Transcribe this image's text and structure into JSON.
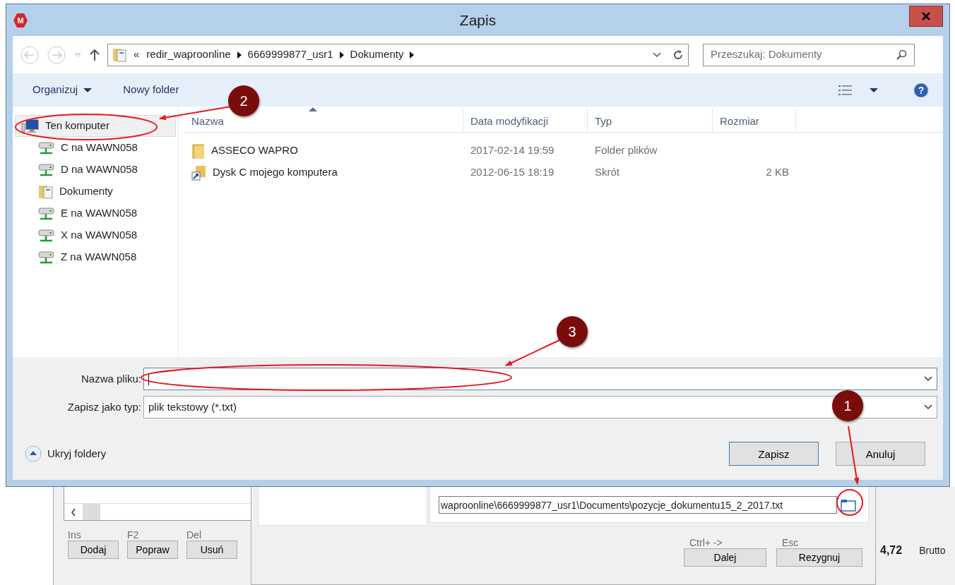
{
  "window": {
    "logo": "M",
    "title": "Zapis"
  },
  "help": "?",
  "address_bar": {
    "overflow": "«",
    "segments": [
      "redir_waproonline",
      "6669999877_usr1",
      "Dokumenty"
    ]
  },
  "search": {
    "placeholder": "Przeszukaj: Dokumenty"
  },
  "toolbar": {
    "items": [
      {
        "label": "Organizuj",
        "kind": "menu"
      },
      {
        "label": "Nowy folder",
        "kind": "button"
      }
    ]
  },
  "nav_tree": {
    "items": [
      {
        "label": "Ten komputer",
        "kind": "computer",
        "selected": true,
        "children": [
          {
            "label": "C na WAWN058",
            "kind": "drive",
            "selected": false
          },
          {
            "label": "D na WAWN058",
            "kind": "drive",
            "selected": false
          },
          {
            "label": "Dokumenty",
            "kind": "library",
            "selected": false
          },
          {
            "label": "E na WAWN058",
            "kind": "drive",
            "selected": false
          },
          {
            "label": "X na WAWN058",
            "kind": "drive",
            "selected": false
          },
          {
            "label": "Z na WAWN058",
            "kind": "drive",
            "selected": false
          }
        ]
      }
    ]
  },
  "file_list": {
    "columns": [
      "Nazwa",
      "Data modyfikacji",
      "Typ",
      "Rozmiar"
    ],
    "rows": [
      {
        "kind": "folder",
        "name": "ASSECO WAPRO",
        "date": "2017-02-14 19:59",
        "type": "Folder plików"
      },
      {
        "kind": "shortcut",
        "name": "Dysk C mojego komputera",
        "date": "2012-06-15 18:19",
        "type": "Skrót",
        "size": "2 KB"
      }
    ]
  },
  "form": {
    "filename": {
      "label": "Nazwa pliku:"
    },
    "filetype": {
      "label": "Zapisz jako typ:",
      "value": "plik tekstowy (*.txt)"
    }
  },
  "hide_folders": "Ukryj foldery",
  "buttons": [
    {
      "label": "Zapisz",
      "default": true
    },
    {
      "label": "Anuluj",
      "default": false
    }
  ],
  "annotations": [
    {
      "number": "1"
    },
    {
      "number": "2"
    },
    {
      "number": "3"
    }
  ],
  "background_app": {
    "shortcut_buttons": [
      {
        "key": "Ins",
        "label": "Dodaj"
      },
      {
        "key": "F2",
        "label": "Popraw"
      },
      {
        "key": "Del",
        "label": "Usuń"
      }
    ],
    "export_path": "waproonline\\6669999877_usr1\\Documents\\pozycje_dokumentu15_2_2017.txt",
    "wizard_buttons": [
      {
        "key": "Ctrl+ ->",
        "label": "Dalej"
      },
      {
        "key": "Esc",
        "label": "Rezygnuj"
      }
    ],
    "total": {
      "value": "4,72",
      "label": "Brutto"
    }
  }
}
